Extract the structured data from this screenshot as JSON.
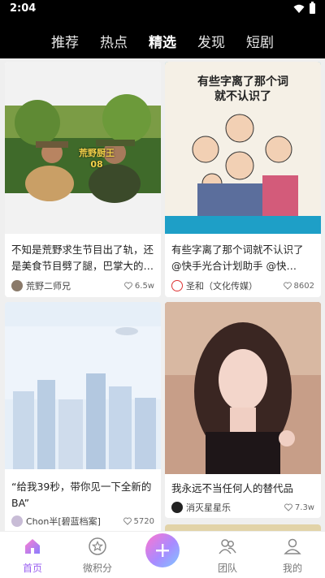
{
  "status": {
    "time": "2:04"
  },
  "tabs": [
    "推荐",
    "热点",
    "精选",
    "发现",
    "短剧"
  ],
  "active_tab": "精选",
  "cards": [
    {
      "image_overlay": "荒野厨王\n08",
      "title": "不知是荒野求生节目出了轨，还是美食节目劈了腿，巴掌大的…",
      "author": "荒野二师兄",
      "likes": "6.5w"
    },
    {
      "image_overlay": "有些字离了那个词\n就不认识了",
      "title": "有些字离了那个词就不认识了　@快手光合计划助手 @快…",
      "author": "圣和（文化传媒）",
      "likes": "8602"
    },
    {
      "title": "“给我39秒，带你见一下全新的BA”",
      "author": "Chon半[碧蓝档案]",
      "likes": "5720"
    },
    {
      "title": "我永远不当任何人的替代品",
      "author": "消灭星星乐",
      "likes": "7.3w"
    }
  ],
  "bottom_nav": [
    {
      "label": "首页",
      "icon": "home-icon"
    },
    {
      "label": "微积分",
      "icon": "star-circle-icon"
    },
    {
      "label": "",
      "icon": "plus-icon"
    },
    {
      "label": "团队",
      "icon": "team-icon"
    },
    {
      "label": "我的",
      "icon": "profile-icon"
    }
  ],
  "colors": {
    "accent": "#9a60f0",
    "top_bar": "#000000",
    "feed_bg": "#efefef"
  }
}
